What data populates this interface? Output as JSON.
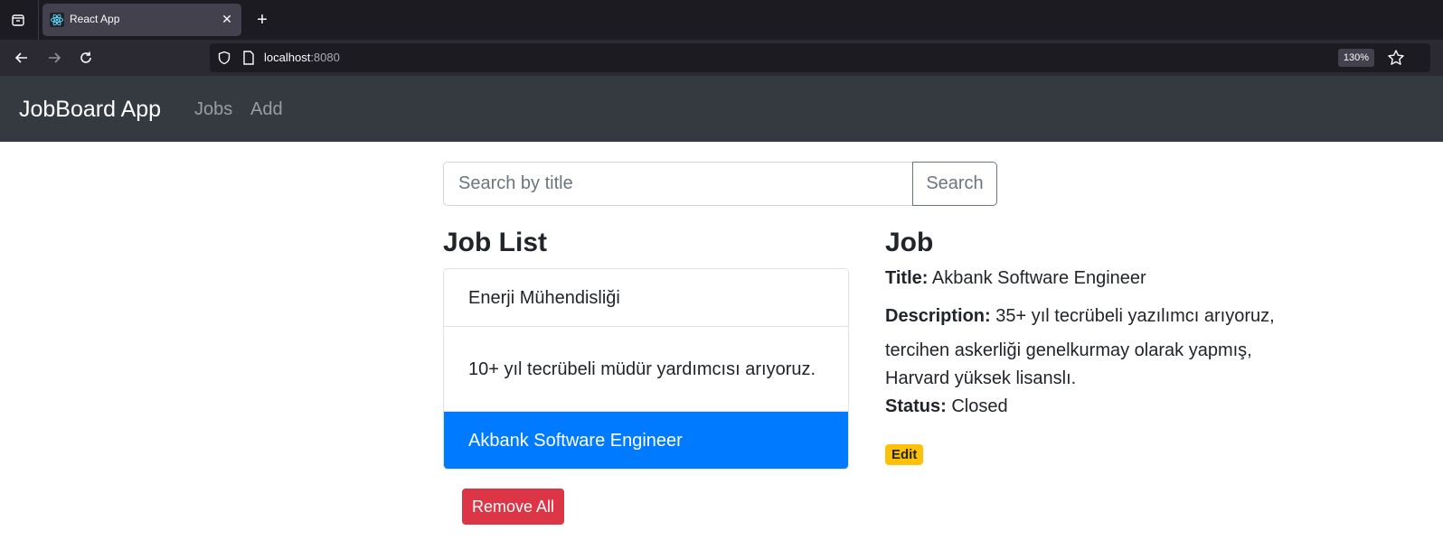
{
  "browser": {
    "tab_title": "React App",
    "url_host": "localhost",
    "url_port": ":8080",
    "zoom": "130%"
  },
  "navbar": {
    "brand": "JobBoard App",
    "links": [
      "Jobs",
      "Add"
    ]
  },
  "search": {
    "placeholder": "Search by title",
    "button_label": "Search"
  },
  "job_list": {
    "heading": "Job List",
    "items": [
      "Enerji Mühendisliği",
      "10+ yıl tecrübeli müdür yardımcısı arıyoruz.",
      "Akbank Software Engineer"
    ],
    "active_index": 2,
    "remove_all_label": "Remove All"
  },
  "job_detail": {
    "heading": "Job",
    "title_label": "Title:",
    "title_value": "Akbank Software Engineer",
    "description_label": "Description:",
    "description_value": "35+ yıl tecrübeli yazılımcı arıyoruz,",
    "description_line2": "tercihen askerliği genelkurmay olarak yapmış,",
    "description_line3": "Harvard yüksek lisanslı.",
    "status_label": "Status:",
    "status_value": "Closed",
    "edit_label": "Edit"
  },
  "colors": {
    "navbar_bg": "#343a40",
    "active_item": "#007bff",
    "danger": "#dc3545",
    "warning": "#ffc107"
  }
}
